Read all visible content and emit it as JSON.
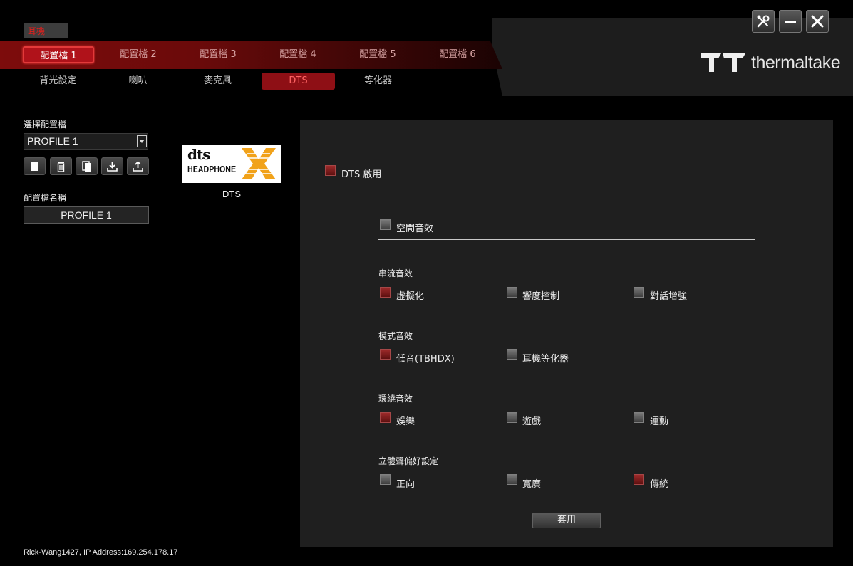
{
  "device_tab": "耳機",
  "window_controls": {
    "settings_icon": "wrench-screwdriver-icon",
    "minimize_icon": "minimize-icon",
    "close_icon": "close-icon"
  },
  "brand": {
    "name": "thermaltake",
    "logo_icon": "tt-logo-icon"
  },
  "profiles": [
    {
      "label": "配置檔 1",
      "active": true
    },
    {
      "label": "配置檔 2",
      "active": false
    },
    {
      "label": "配置檔 3",
      "active": false
    },
    {
      "label": "配置檔 4",
      "active": false
    },
    {
      "label": "配置檔 5",
      "active": false
    },
    {
      "label": "配置檔 6",
      "active": false
    }
  ],
  "sub_tabs": [
    {
      "label": "背光設定",
      "active": false
    },
    {
      "label": "喇叭",
      "active": false
    },
    {
      "label": "麥克風",
      "active": false
    },
    {
      "label": "DTS",
      "active": true
    },
    {
      "label": "等化器",
      "active": false
    }
  ],
  "left_panel": {
    "select_profile_label": "選擇配置檔",
    "selected_profile": "PROFILE 1",
    "tools": [
      "new-icon",
      "delete-icon",
      "copy-icon",
      "import-icon",
      "export-icon"
    ],
    "profile_name_label": "配置檔名稱",
    "profile_name_value": "PROFILE 1"
  },
  "dts_badge": {
    "line1": "dts",
    "line2": "HEADPHONE",
    "mark": "X",
    "caption": "DTS"
  },
  "main": {
    "dts_enable": {
      "label": "DTS 啟用",
      "checked": true
    },
    "spatial": {
      "label": "空間音效",
      "checked": false
    },
    "groups": [
      {
        "title": "串流音效",
        "options": [
          {
            "label": "虛擬化",
            "checked": true
          },
          {
            "label": "響度控制",
            "checked": false
          },
          {
            "label": "對話增強",
            "checked": false
          }
        ]
      },
      {
        "title": "模式音效",
        "options": [
          {
            "label": "低音(TBHDX)",
            "checked": true
          },
          {
            "label": "耳機等化器",
            "checked": false
          }
        ]
      },
      {
        "title": "環繞音效",
        "options": [
          {
            "label": "娛樂",
            "checked": true
          },
          {
            "label": "遊戲",
            "checked": false
          },
          {
            "label": "運動",
            "checked": false
          }
        ]
      },
      {
        "title": "立體聲偏好設定",
        "options": [
          {
            "label": "正向",
            "checked": false
          },
          {
            "label": "寬廣",
            "checked": false
          },
          {
            "label": "傳統",
            "checked": true
          }
        ]
      }
    ],
    "apply_label": "套用"
  },
  "status": "Rick-Wang1427, IP Address:169.254.178.17",
  "colors": {
    "accent_red": "#b0121a",
    "panel": "#1f1f1f",
    "checked": "#7a1c1c"
  }
}
